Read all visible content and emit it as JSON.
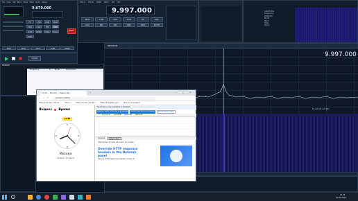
{
  "sdr": {
    "left": {
      "menu_items": [
        "File",
        "View",
        "DSP",
        "Band",
        "Mode",
        "Filter",
        "Audio",
        "Setup"
      ],
      "frequency": "9.970.000",
      "mode_buttons": [
        "LSB",
        "USB",
        "DSB",
        "CWL",
        "CWU",
        "FM",
        "AM",
        "SAM",
        "SPEC",
        "DIGL",
        "DIGU",
        "DRM"
      ],
      "band_buttons": [
        "160",
        "80",
        "60",
        "40",
        "30",
        "20",
        "17",
        "15",
        "12",
        "10",
        "6",
        "2",
        "WWV",
        "GEN"
      ],
      "tx_label": "TX",
      "power_label": "PWR",
      "start_label": "START",
      "rx_tabs": [
        "RX1",
        "RX2",
        "RX3",
        "SUB",
        "MON"
      ],
      "list_headers": [
        "Frequency",
        "S",
        "Mode",
        "Description"
      ],
      "list_title": "MEMORY"
    },
    "center": {
      "frequency": "9.997.000",
      "top_labels": [
        "VFO A",
        "VFO B",
        "TUNE",
        "SPLIT",
        "RIT",
        "XIT"
      ],
      "small_buttons": [
        "MOX",
        "TUN",
        "VOX",
        "DUP",
        "PS",
        "SQL",
        "AGC",
        "NB",
        "NR",
        "ANF",
        "BIN",
        "MUTE"
      ],
      "center_panel_title": "SPECTRUM"
    },
    "right": {
      "menu_lines": [
        "AutoFollow",
        "Frequency",
        "Waterfall",
        "Mode",
        "Band",
        "Filter",
        "Zoom"
      ],
      "top_frequency": "9.997.000",
      "status": "S9+10 dB  -63 dBm"
    },
    "bottom_status": "VFO A  9.997.000 MHz  AM  Filter 6.0 kHz"
  },
  "chrome": {
    "tab_title": "11:36 — Москва — Яндекс.Вр...",
    "address": "yandex.ru/time/",
    "bookmarks": [
      "https://yandex.ru/time...",
      "https://...",
      "https://music.yandex...",
      "https://translate.goo...",
      "Другие закладки"
    ],
    "notice": "DevTools is now available in Russian!",
    "notice_buttons": [
      "Always match Chrome's language",
      "Switch DevTools to Russian",
      "Don't show again"
    ],
    "devtools_tabs": [
      "Elements",
      "Console",
      "Sources",
      "Network"
    ],
    "logo": "Яндекс",
    "service": "Время",
    "time_badge": "11:36",
    "city": "Москва",
    "date": "Четверг, 23 марта",
    "drawer_tabs": [
      "Console",
      "What's New"
    ],
    "highlight_text": "Highlights from the Chrome 111 update",
    "feature_title": "Override HTTP response headers in the Network panel",
    "feature_text": "Specify HTTP response headers locally to"
  },
  "taskbar": {
    "time": "11:36",
    "date": "23.03.2023"
  }
}
